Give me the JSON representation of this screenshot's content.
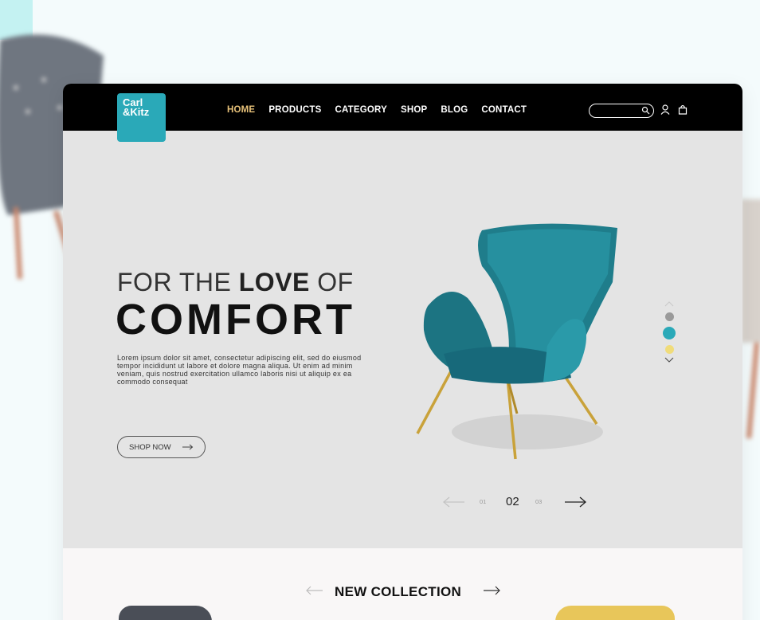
{
  "brand": {
    "logo_text": "Carl\n&Kitz",
    "color": "#2aa9b8"
  },
  "nav": {
    "items": [
      {
        "label": "HOME",
        "active": true
      },
      {
        "label": "PRODUCTS",
        "active": false
      },
      {
        "label": "CATEGORY",
        "active": false
      },
      {
        "label": "SHOP",
        "active": false
      },
      {
        "label": "BLOG",
        "active": false
      },
      {
        "label": "CONTACT",
        "active": false
      }
    ],
    "active_color": "#e9c37a",
    "icons": [
      "search-icon",
      "user-icon",
      "cart-icon"
    ]
  },
  "search": {
    "placeholder": ""
  },
  "hero": {
    "line1_thin_a": "FOR THE ",
    "line1_bold": "LOVE",
    "line1_thin_b": " OF",
    "line2": "COMFORT",
    "description": "Lorem ipsum dolor sit amet, consectetur adipiscing elit, sed do eiusmod tempor incididunt ut labore et dolore magna aliqua. Ut enim ad minim veniam, quis nostrud exercitation ullamco laboris nisi ut aliquip ex ea commodo consequat",
    "cta_label": "SHOP NOW",
    "color_options": [
      "#9a9a9a",
      "#2aa9b8",
      "#f0dc7a"
    ]
  },
  "pager": {
    "prev": "01",
    "current": "02",
    "next": "03"
  },
  "collection": {
    "title": "NEW COLLECTION"
  }
}
